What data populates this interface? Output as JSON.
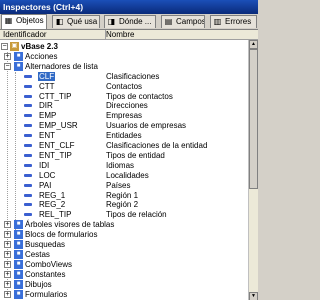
{
  "window": {
    "title": "Inspectores (Ctrl+4)"
  },
  "tabs": [
    {
      "label": "Objetos",
      "icon": "objects-icon"
    },
    {
      "label": "Qué usa",
      "icon": "uses-icon"
    },
    {
      "label": "Dónde ...",
      "icon": "where-icon"
    },
    {
      "label": "Campos",
      "icon": "fields-icon"
    },
    {
      "label": "Errores",
      "icon": "errors-icon"
    }
  ],
  "grid": {
    "col1": "Identificador",
    "col2": "Nombre"
  },
  "tree": {
    "root": "vBase 2.3",
    "nodes": [
      {
        "label": "Acciones"
      },
      {
        "label": "Alternadores de lista"
      },
      {
        "label": "Árboles visores de tablas"
      },
      {
        "label": "Blocs de formularios"
      },
      {
        "label": "Busquedas"
      },
      {
        "label": "Cestas"
      },
      {
        "label": "ComboViews"
      },
      {
        "label": "Constantes"
      },
      {
        "label": "Dibujos"
      },
      {
        "label": "Formularios"
      }
    ],
    "children": [
      {
        "id": "CLF",
        "name": "Clasificaciones"
      },
      {
        "id": "CTT",
        "name": "Contactos"
      },
      {
        "id": "CTT_TIP",
        "name": "Tipos de contactos"
      },
      {
        "id": "DIR",
        "name": "Direcciones"
      },
      {
        "id": "EMP",
        "name": "Empresas"
      },
      {
        "id": "EMP_USR",
        "name": "Usuarios de empresas"
      },
      {
        "id": "ENT",
        "name": "Entidades"
      },
      {
        "id": "ENT_CLF",
        "name": "Clasificaciones de la entidad"
      },
      {
        "id": "ENT_TIP",
        "name": "Tipos de entidad"
      },
      {
        "id": "IDI",
        "name": "Idiomas"
      },
      {
        "id": "LOC",
        "name": "Localidades"
      },
      {
        "id": "PAI",
        "name": "Países"
      },
      {
        "id": "REG_1",
        "name": "Región 1"
      },
      {
        "id": "REG_2",
        "name": "Región 2"
      },
      {
        "id": "REL_TIP",
        "name": "Tipos de relación"
      }
    ]
  },
  "colors": {
    "titlebar": "#0a2a7a",
    "selection": "#316ac5",
    "field_icon": "#3b5fd0"
  }
}
